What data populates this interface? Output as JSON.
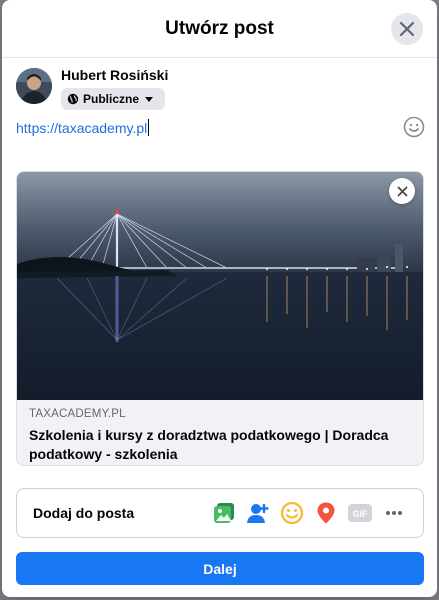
{
  "dialog": {
    "title": "Utwórz post"
  },
  "user": {
    "name": "Hubert Rosiński",
    "privacy": "Publiczne"
  },
  "composer": {
    "text": "https://taxacademy.pl"
  },
  "link_preview": {
    "domain": "TAXACADEMY.PL",
    "title": "Szkolenia i kursy z doradztwa podatkowego | Doradca podatkowy - szkolenia"
  },
  "add_to_post": {
    "label": "Dodaj do posta",
    "icons": [
      "photo-video-icon",
      "tag-people-icon",
      "feeling-icon",
      "location-icon",
      "gif-icon",
      "more-icon"
    ],
    "gif_text": "GIF"
  },
  "submit": {
    "label": "Dalej"
  },
  "colors": {
    "accent": "#1877f2",
    "link": "#216fdb",
    "photo": "#45bd62",
    "tag": "#1877f2",
    "feeling": "#f7b928",
    "location": "#f5533d"
  }
}
